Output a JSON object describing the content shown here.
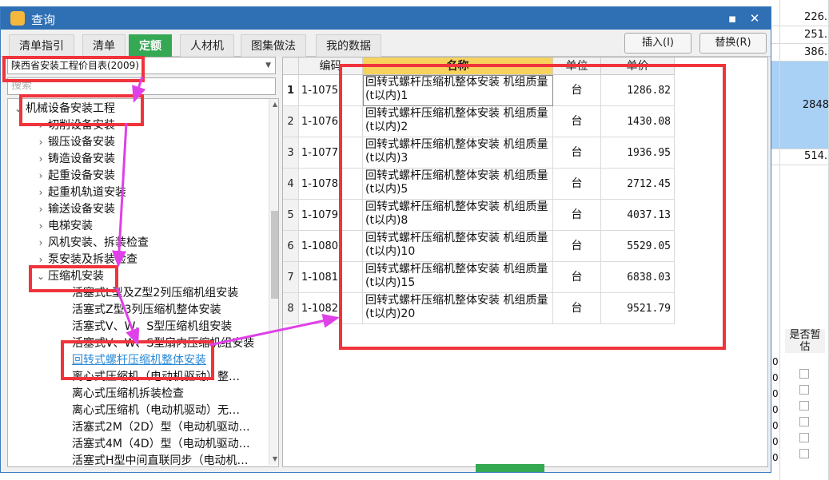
{
  "dialog": {
    "title": "查询",
    "tabs": [
      {
        "label": "清单指引",
        "active": false
      },
      {
        "label": "清单",
        "active": false
      },
      {
        "label": "定额",
        "active": true
      },
      {
        "label": "人材机",
        "active": false
      },
      {
        "label": "图集做法",
        "active": false
      },
      {
        "label": "我的数据",
        "active": false
      }
    ],
    "insert_label": "插入(I)",
    "replace_label": "替换(R)"
  },
  "left_panel": {
    "library_select": "陕西省安装工程价目表(2009)",
    "search_placeholder": "搜索",
    "tree": [
      {
        "label": "机械设备安装工程",
        "level": 0,
        "caret": "expanded"
      },
      {
        "label": "切削设备安装",
        "level": 1,
        "caret": "collapsed"
      },
      {
        "label": "锻压设备安装",
        "level": 1,
        "caret": "collapsed"
      },
      {
        "label": "铸造设备安装",
        "level": 1,
        "caret": "collapsed"
      },
      {
        "label": "起重设备安装",
        "level": 1,
        "caret": "collapsed"
      },
      {
        "label": "起重机轨道安装",
        "level": 1,
        "caret": "collapsed"
      },
      {
        "label": "输送设备安装",
        "level": 1,
        "caret": "collapsed"
      },
      {
        "label": "电梯安装",
        "level": 1,
        "caret": "collapsed"
      },
      {
        "label": "风机安装、拆装检查",
        "level": 1,
        "caret": "collapsed"
      },
      {
        "label": "泵安装及拆装检查",
        "level": 1,
        "caret": "collapsed"
      },
      {
        "label": "压缩机安装",
        "level": 1,
        "caret": "expanded"
      },
      {
        "label": "活塞式L型及Z型2列压缩机组安装",
        "level": 2,
        "caret": "none"
      },
      {
        "label": "活塞式Z型3列压缩机整体安装",
        "level": 2,
        "caret": "none"
      },
      {
        "label": "活塞式V、W、S型压缩机组安装",
        "level": 2,
        "caret": "none"
      },
      {
        "label": "活塞式V、W、S型扇内压缩机组安装",
        "level": 2,
        "caret": "none"
      },
      {
        "label": "回转式螺杆压缩机整体安装",
        "level": 2,
        "caret": "none",
        "selected": true
      },
      {
        "label": "离心式压缩机（电动机驱动）整…",
        "level": 2,
        "caret": "none"
      },
      {
        "label": "离心式压缩机拆装检查",
        "level": 2,
        "caret": "none"
      },
      {
        "label": "离心式压缩机（电动机驱动）无…",
        "level": 2,
        "caret": "none"
      },
      {
        "label": "活塞式2M（2D）型（电动机驱动…",
        "level": 2,
        "caret": "none"
      },
      {
        "label": "活塞式4M（4D）型（电动机驱动…",
        "level": 2,
        "caret": "none"
      },
      {
        "label": "活塞式H型中间直联同步（电动机…",
        "level": 2,
        "caret": "none"
      }
    ]
  },
  "table": {
    "headers": {
      "index": "",
      "code": "编码",
      "name": "名称",
      "unit": "单位",
      "price": "单价"
    },
    "rows": [
      {
        "index": "1",
        "code": "1-1075",
        "name": "回转式螺杆压缩机整体安装 机组质量(t以内)1",
        "unit": "台",
        "price": "1286.82"
      },
      {
        "index": "2",
        "code": "1-1076",
        "name": "回转式螺杆压缩机整体安装 机组质量(t以内)2",
        "unit": "台",
        "price": "1430.08"
      },
      {
        "index": "3",
        "code": "1-1077",
        "name": "回转式螺杆压缩机整体安装 机组质量(t以内)3",
        "unit": "台",
        "price": "1936.95"
      },
      {
        "index": "4",
        "code": "1-1078",
        "name": "回转式螺杆压缩机整体安装 机组质量(t以内)5",
        "unit": "台",
        "price": "2712.45"
      },
      {
        "index": "5",
        "code": "1-1079",
        "name": "回转式螺杆压缩机整体安装 机组质量(t以内)8",
        "unit": "台",
        "price": "4037.13"
      },
      {
        "index": "6",
        "code": "1-1080",
        "name": "回转式螺杆压缩机整体安装 机组质量(t以内)10",
        "unit": "台",
        "price": "5529.05"
      },
      {
        "index": "7",
        "code": "1-1081",
        "name": "回转式螺杆压缩机整体安装 机组质量(t以内)15",
        "unit": "台",
        "price": "6838.03"
      },
      {
        "index": "8",
        "code": "1-1082",
        "name": "回转式螺杆压缩机整体安装 机组质量(t以内)20",
        "unit": "台",
        "price": "9521.79"
      }
    ]
  },
  "background_sheet": {
    "values": [
      "226.",
      "251.",
      "386.",
      "2848",
      "514."
    ],
    "right_header": "是否暂估",
    "zero_values": [
      "0",
      "0",
      "0",
      "0",
      "0",
      "0",
      "0",
      "0"
    ]
  },
  "colors": {
    "annotation_red": "#f0343c",
    "annotation_magenta": "#e040e8",
    "tab_active_green": "#35a854",
    "titlebar_blue": "#2f6fb3",
    "name_header_yellow": "#f7d35e"
  },
  "icons": {
    "app": "app-logo-icon",
    "minimize": "minimize-icon",
    "close": "close-icon"
  }
}
